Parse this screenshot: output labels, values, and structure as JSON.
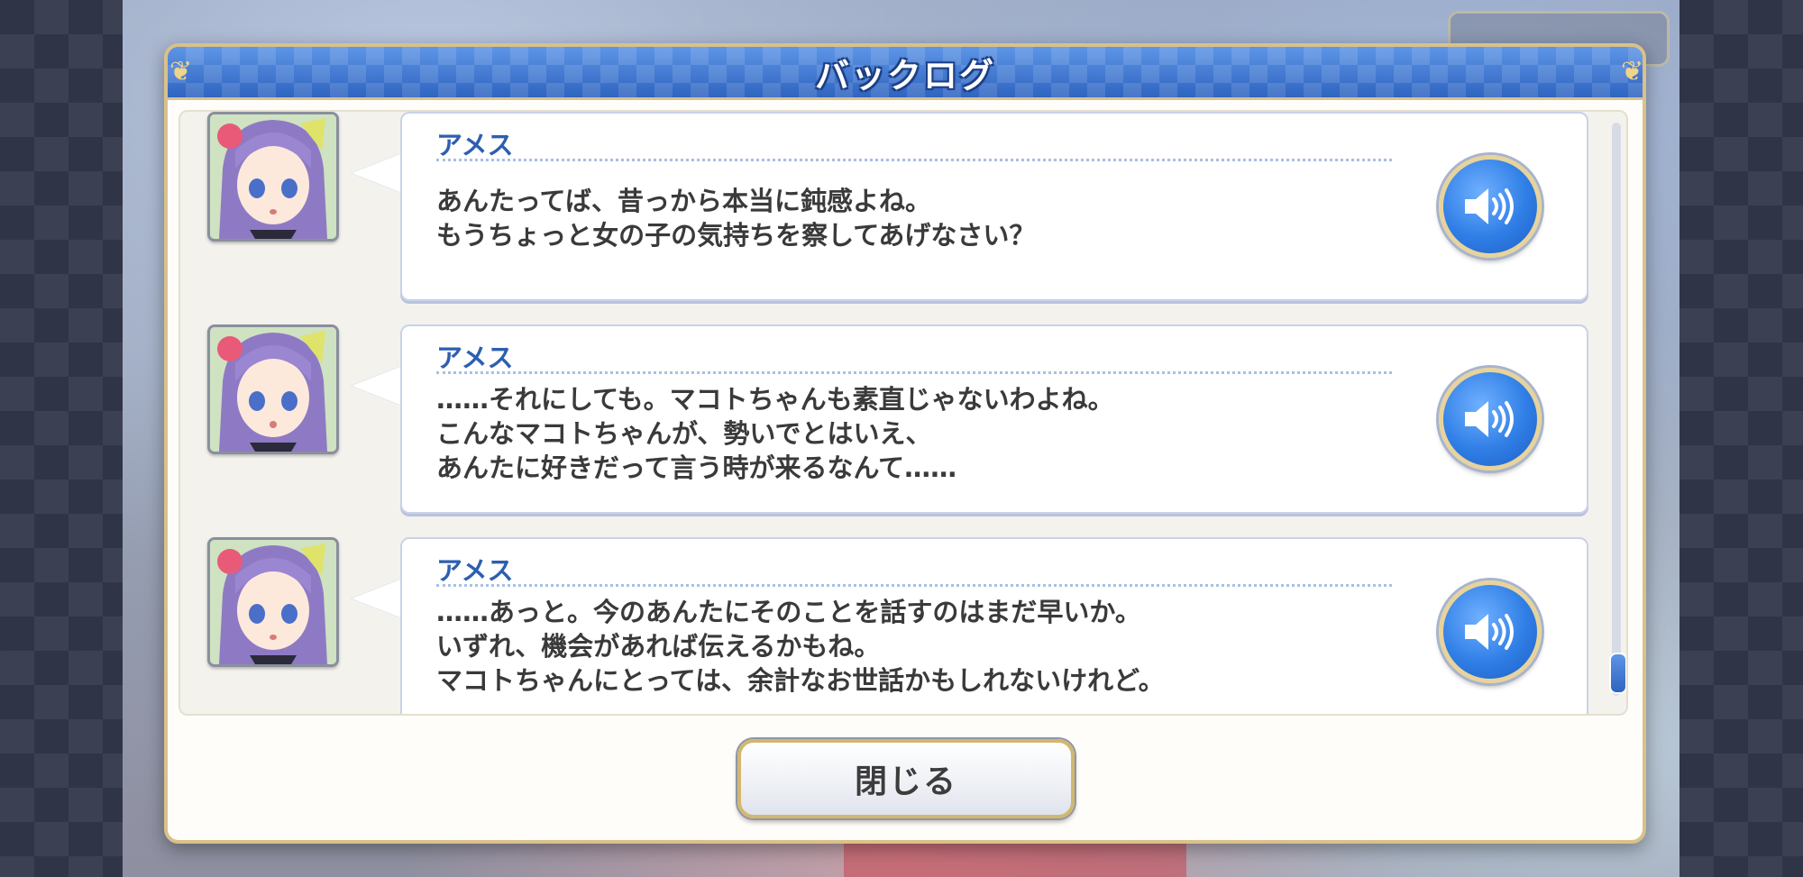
{
  "window": {
    "title": "バックログ"
  },
  "entries": [
    {
      "speaker": "アメス",
      "lines": [
        "あんたってば、昔っから本当に鈍感よね。",
        "もうちょっと女の子の気持ちを察してあげなさい？"
      ]
    },
    {
      "speaker": "アメス",
      "lines": [
        "……それにしても。マコトちゃんも素直じゃないわよね。",
        "こんなマコトちゃんが、勢いでとはいえ、",
        "あんたに好きだって言う時が来るなんて……"
      ]
    },
    {
      "speaker": "アメス",
      "lines": [
        "……あっと。今のあんたにそのことを話すのはまだ早いか。",
        "いずれ、機会があれば伝えるかもね。",
        "マコトちゃんにとっては、余計なお世話かもしれないけれど。"
      ]
    }
  ],
  "close_button": {
    "label": "閉じる"
  },
  "icons": {
    "voice": "speaker-sound-icon",
    "avatar": "character-portrait"
  },
  "colors": {
    "title_bar": "#3f78d4",
    "speaker_name": "#2d5fb0",
    "frame_gold": "#d9c18a",
    "voice_button": "#2f7ee6"
  }
}
